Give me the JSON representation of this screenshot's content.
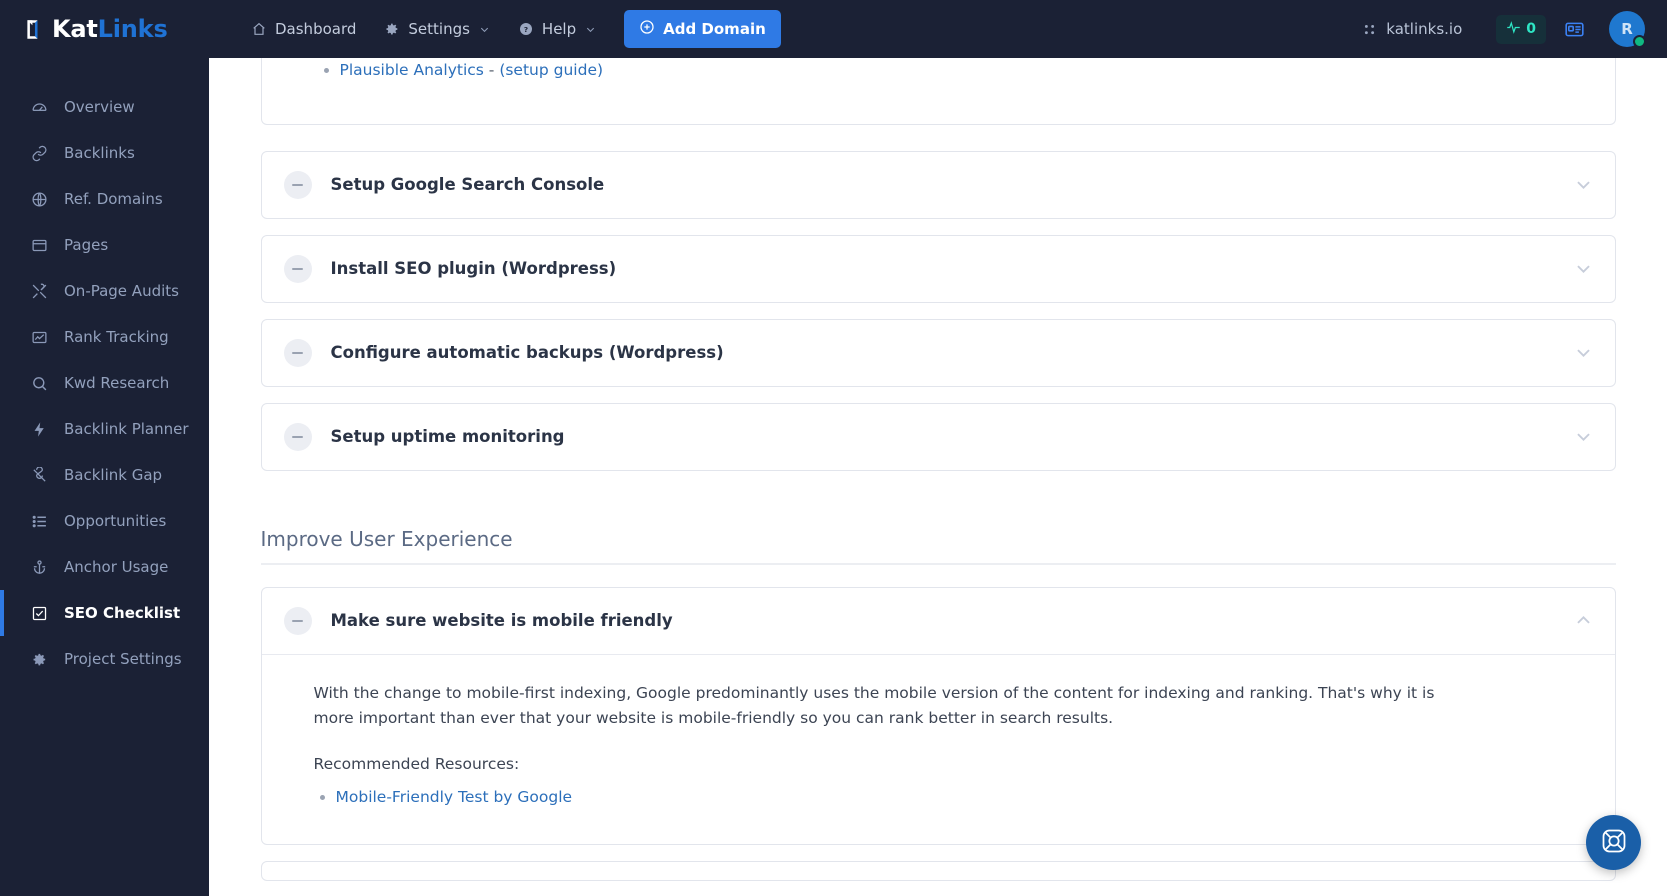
{
  "brand": {
    "name_part1": "Kat",
    "name_part2": "Links",
    "logo_icon": "cat-head-icon"
  },
  "sidebar": {
    "items": [
      {
        "label": "Overview",
        "icon": "gauge-icon",
        "active": false
      },
      {
        "label": "Backlinks",
        "icon": "link-chain-icon",
        "active": false
      },
      {
        "label": "Ref. Domains",
        "icon": "globe-icon",
        "active": false
      },
      {
        "label": "Pages",
        "icon": "window-icon",
        "active": false
      },
      {
        "label": "On-Page Audits",
        "icon": "tools-icon",
        "active": false
      },
      {
        "label": "Rank Tracking",
        "icon": "chart-line-icon",
        "active": false
      },
      {
        "label": "Kwd Research",
        "icon": "search-icon",
        "active": false
      },
      {
        "label": "Backlink Planner",
        "icon": "bolt-icon",
        "active": false
      },
      {
        "label": "Backlink Gap",
        "icon": "broken-link-icon",
        "active": false
      },
      {
        "label": "Opportunities",
        "icon": "list-icon",
        "active": false
      },
      {
        "label": "Anchor Usage",
        "icon": "anchor-icon",
        "active": false
      },
      {
        "label": "SEO Checklist",
        "icon": "checkbox-icon",
        "active": true
      },
      {
        "label": "Project Settings",
        "icon": "gear-icon",
        "active": false
      }
    ]
  },
  "topbar": {
    "dashboard_label": "Dashboard",
    "settings_label": "Settings",
    "help_label": "Help",
    "add_domain_label": "Add Domain",
    "site_name": "katlinks.io",
    "live_count": "0",
    "avatar_initial": "R"
  },
  "main": {
    "clipped_card": {
      "resource_text": "Plausible Analytics",
      "separator": " - ",
      "guide_label": "(setup guide)"
    },
    "collapsed_items": [
      {
        "title": "Setup Google Search Console",
        "status": "incomplete"
      },
      {
        "title": "Install SEO plugin (Wordpress)",
        "status": "incomplete"
      },
      {
        "title": "Configure automatic backups (Wordpress)",
        "status": "incomplete"
      },
      {
        "title": "Setup uptime monitoring",
        "status": "incomplete"
      }
    ],
    "section_heading": "Improve User Experience",
    "expanded_item": {
      "title": "Make sure website is mobile friendly",
      "status": "incomplete",
      "paragraph": "With the change to mobile-first indexing, Google predominantly uses the mobile version of the content for indexing and ranking. That's why it is more important than ever that your website is mobile-friendly so you can rank better in search results.",
      "resources_label": "Recommended Resources:",
      "resources": [
        {
          "label": "Mobile-Friendly Test by Google"
        }
      ]
    }
  },
  "support": {
    "icon": "life-ring-icon"
  },
  "colors": {
    "accent": "#2f7ae5",
    "sidebar_bg": "#1b2135",
    "link": "#2c6fba",
    "live_badge": "#2ee6c5",
    "online_dot": "#10b981"
  }
}
